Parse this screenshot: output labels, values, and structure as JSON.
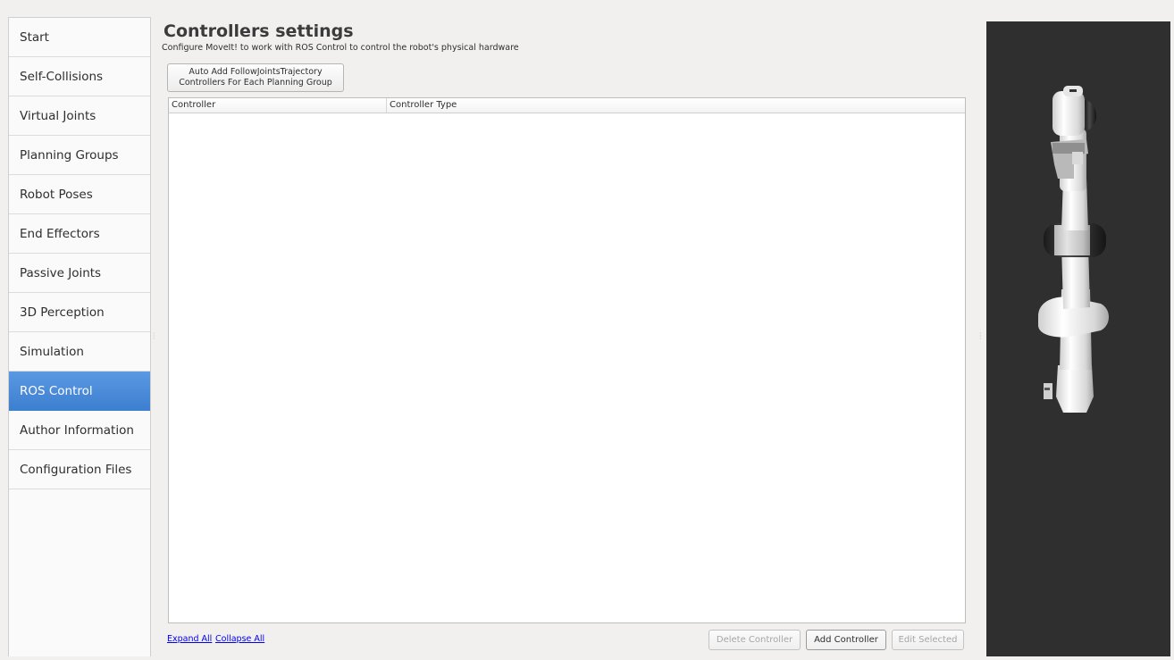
{
  "sidebar": {
    "items": [
      {
        "label": "Start"
      },
      {
        "label": "Self-Collisions"
      },
      {
        "label": "Virtual Joints"
      },
      {
        "label": "Planning Groups"
      },
      {
        "label": "Robot Poses"
      },
      {
        "label": "End Effectors"
      },
      {
        "label": "Passive Joints"
      },
      {
        "label": "3D Perception"
      },
      {
        "label": "Simulation"
      },
      {
        "label": "ROS Control"
      },
      {
        "label": "Author Information"
      },
      {
        "label": "Configuration Files"
      }
    ],
    "active": "ROS Control"
  },
  "header": {
    "title": "Controllers settings",
    "subtitle": "Configure MoveIt! to work with ROS Control to control the robot's physical hardware"
  },
  "auto_add_button": {
    "line1": "Auto Add FollowJointsTrajectory",
    "line2": "Controllers For Each Planning Group"
  },
  "table": {
    "columns": [
      "Controller",
      "Controller Type"
    ],
    "rows": []
  },
  "footer": {
    "expand_all": "Expand All",
    "collapse_all": "Collapse All",
    "delete_controller": "Delete Controller",
    "add_controller": "Add Controller",
    "edit_selected": "Edit Selected"
  },
  "colors": {
    "accent": "#4a8ad8",
    "viewer_background": "#2f2f2f"
  }
}
